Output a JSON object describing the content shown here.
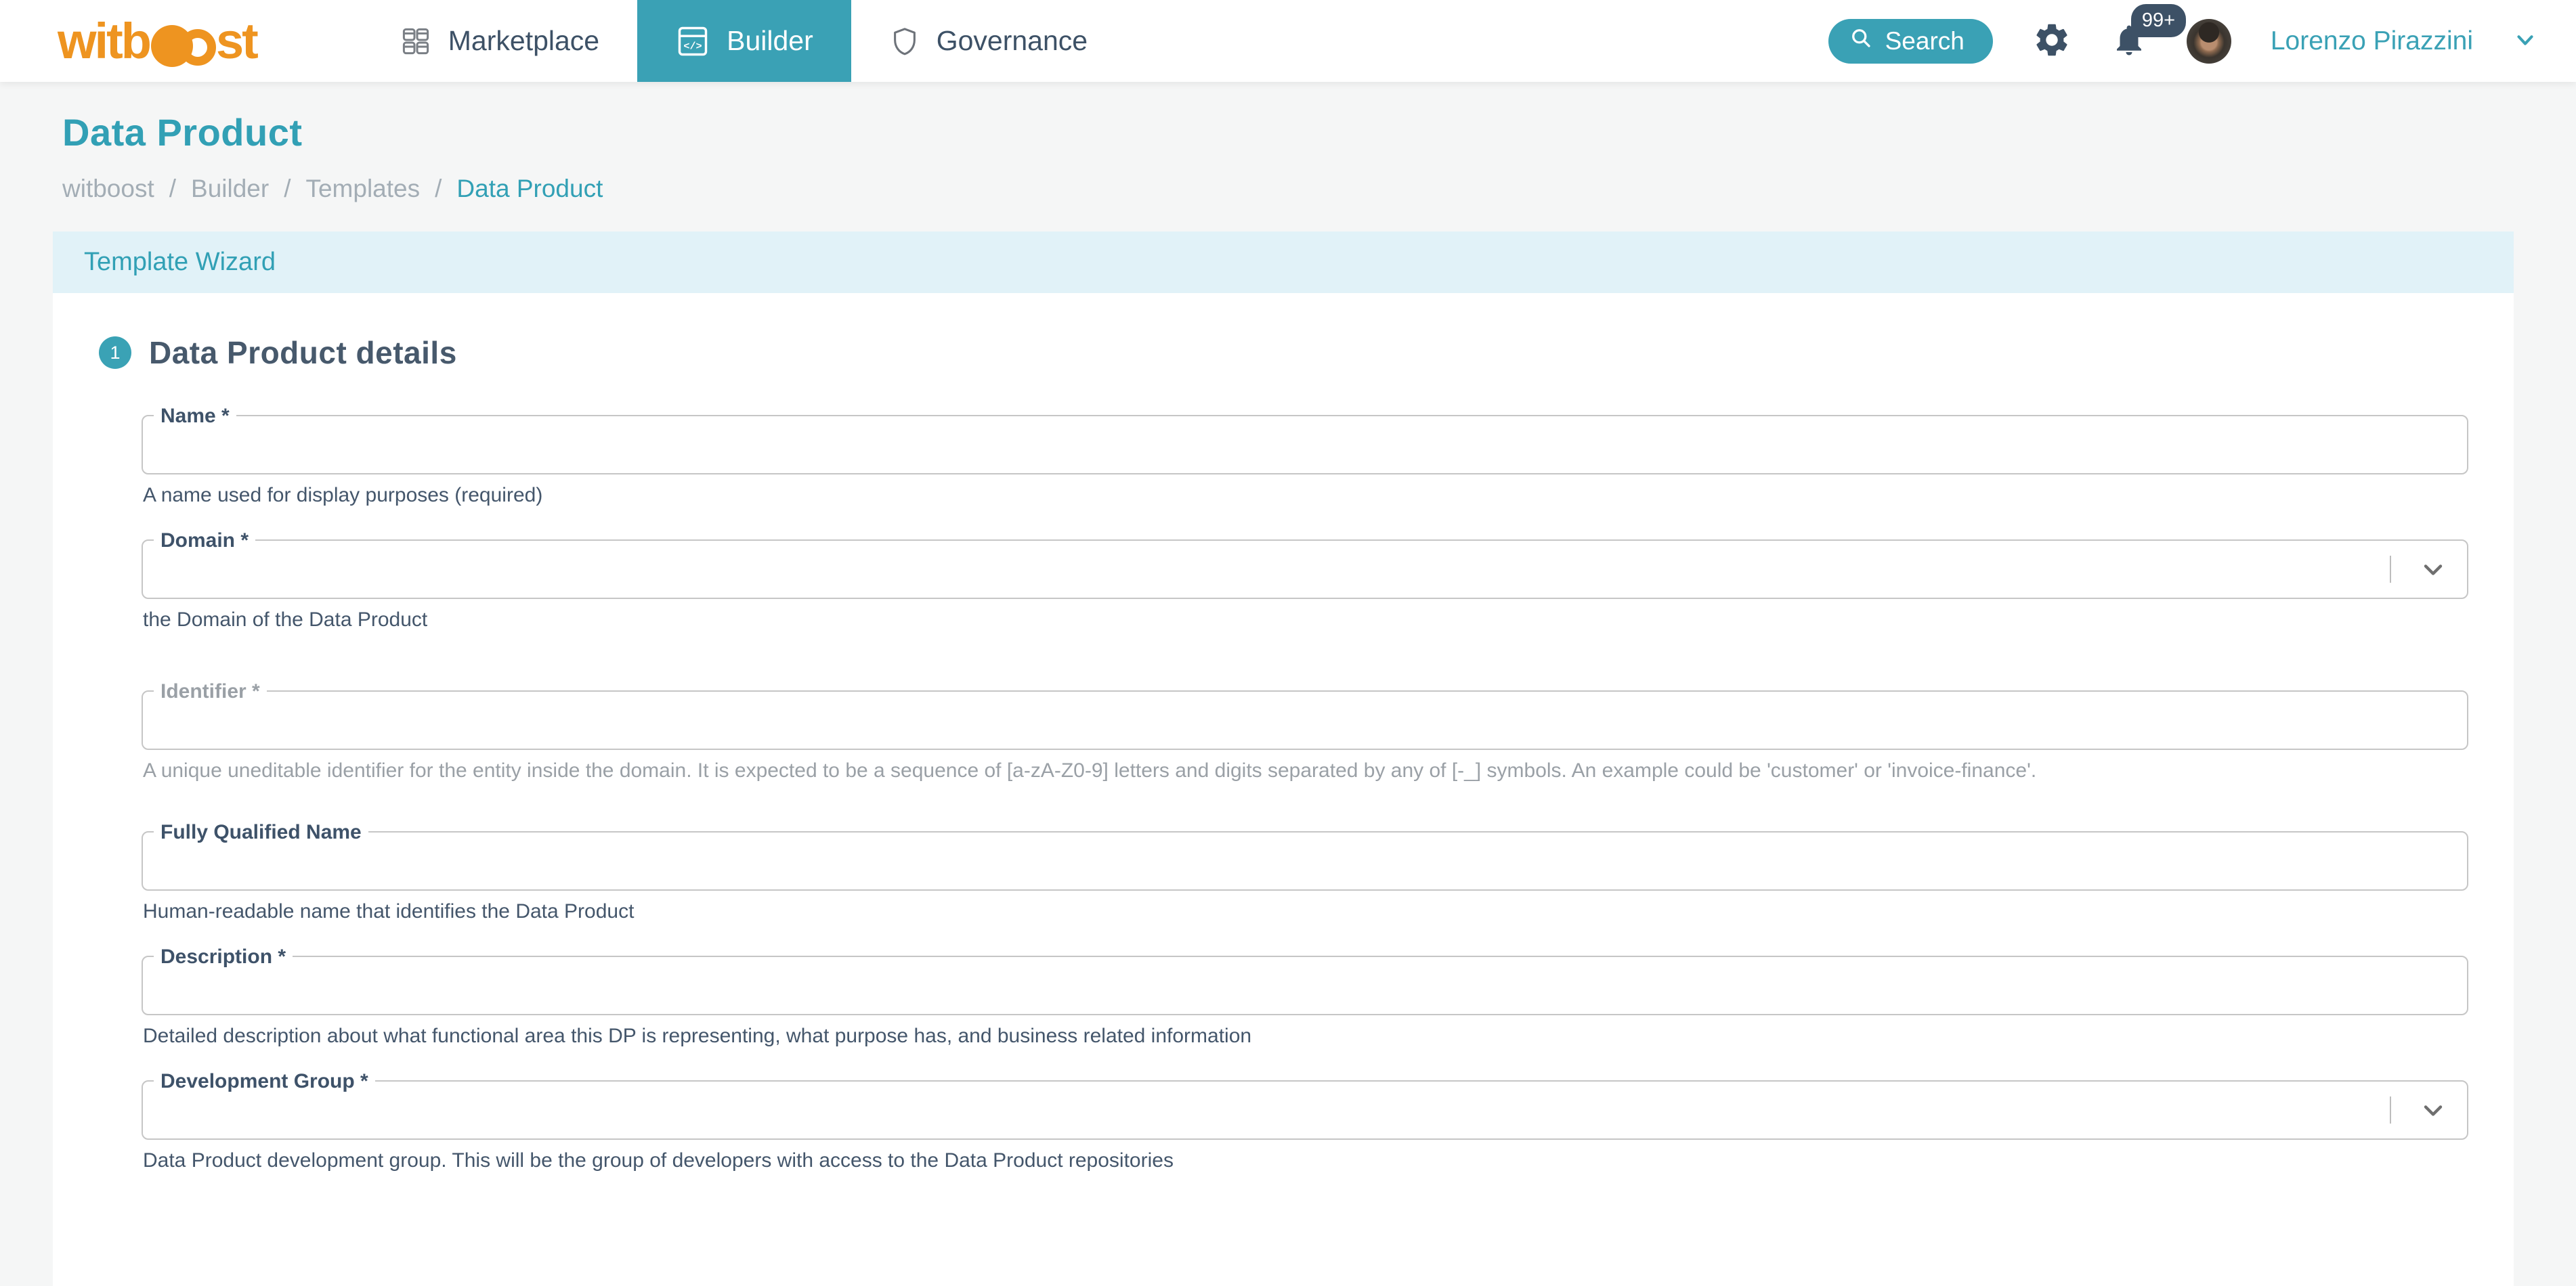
{
  "navbar": {
    "logo": {
      "part1": "witb",
      "part2": "st"
    },
    "items": [
      {
        "label": "Marketplace"
      },
      {
        "label": "Builder"
      },
      {
        "label": "Governance"
      }
    ],
    "search_label": "Search",
    "notifications_badge": "99+",
    "user_name": "Lorenzo Pirazzini"
  },
  "page": {
    "title": "Data Product",
    "breadcrumb": {
      "items": [
        "witboost",
        "Builder",
        "Templates",
        "Data Product"
      ],
      "separator": "/"
    },
    "wizard_header": "Template Wizard",
    "step_number": "1",
    "step_title": "Data Product details"
  },
  "form": {
    "fields": [
      {
        "label": "Name *",
        "value": "",
        "type": "text",
        "helper": "A name used for display purposes (required)"
      },
      {
        "label": "Domain *",
        "value": "",
        "type": "select",
        "helper": "the Domain of the Data Product"
      },
      {
        "label": "Identifier *",
        "value": "",
        "type": "text",
        "disabled": true,
        "helper": "A unique uneditable identifier for the entity inside the domain. It is expected to be a sequence of [a-zA-Z0-9] letters and digits separated by any of [-_] symbols. An example could be 'customer' or 'invoice-finance'."
      },
      {
        "label": "Fully Qualified Name",
        "value": "",
        "type": "text",
        "helper": "Human-readable name that identifies the Data Product"
      },
      {
        "label": "Description *",
        "value": "",
        "type": "text",
        "helper": "Detailed description about what functional area this DP is representing, what purpose has, and business related information"
      },
      {
        "label": "Development Group *",
        "value": "",
        "type": "select",
        "helper": "Data Product development group. This will be the group of developers with access to the Data Product repositories"
      }
    ]
  },
  "colors": {
    "accent_teal": "#3aa1b5",
    "brand_orange": "#ee9420",
    "slate_text": "#3d5166",
    "heading_slate": "#47596c",
    "wizard_band_bg": "#e1f2f8",
    "page_bg": "#f5f6f6",
    "disabled_gray": "#9aa0a6",
    "input_border": "#c6c6c6"
  }
}
